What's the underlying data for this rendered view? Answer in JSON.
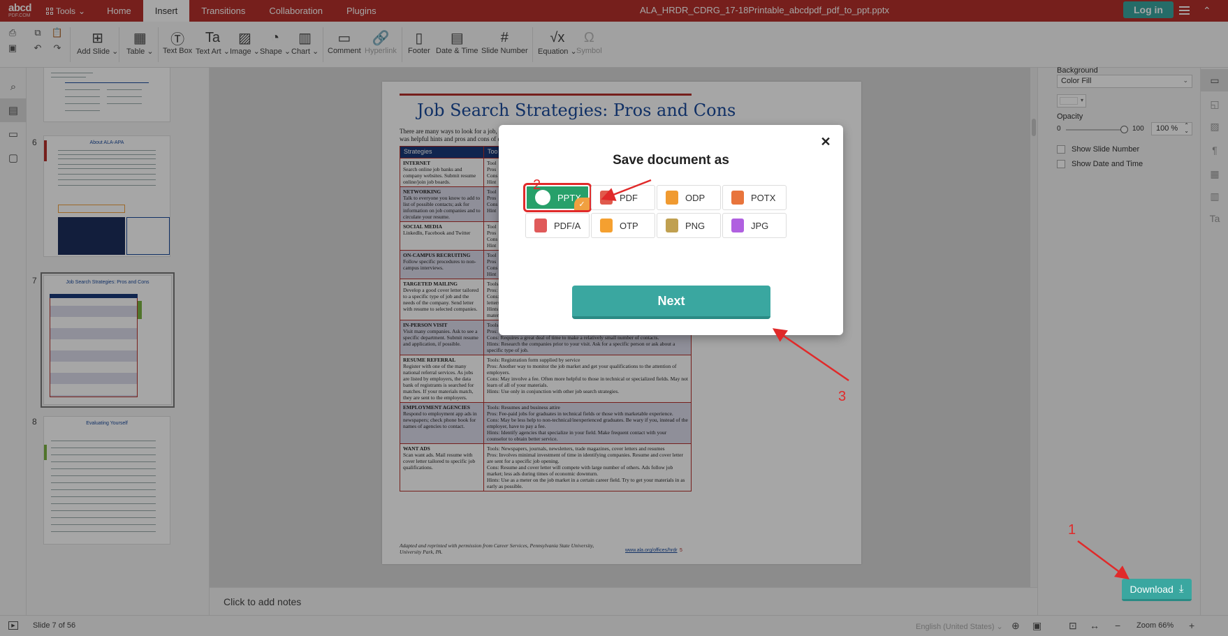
{
  "app": {
    "logo_main": "abcd",
    "logo_sub": "PDF.COM",
    "tools_label": "Tools",
    "doc_title": "ALA_HRDR_CDRG_17-18Printable_abcdpdf_pdf_to_ppt.pptx",
    "login_label": "Log in"
  },
  "menu_tabs": [
    {
      "label": "Home"
    },
    {
      "label": "Insert"
    },
    {
      "label": "Transitions"
    },
    {
      "label": "Collaboration"
    },
    {
      "label": "Plugins"
    }
  ],
  "ribbon": {
    "add_slide": "Add Slide",
    "table": "Table",
    "text_box": "Text Box",
    "text_art": "Text Art",
    "image": "Image",
    "shape": "Shape",
    "chart": "Chart",
    "comment": "Comment",
    "hyperlink": "Hyperlink",
    "footer": "Footer",
    "date_time": "Date & Time",
    "slide_number": "Slide Number",
    "equation": "Equation",
    "symbol": "Symbol"
  },
  "thumbnails": [
    {
      "num": "6",
      "title": "About ALA-APA"
    },
    {
      "num": "7",
      "title": "Job Search Strategies: Pros and Cons"
    },
    {
      "num": "8",
      "title": "Evaluating Yourself"
    }
  ],
  "slide": {
    "title": "Job Search Strategies: Pros and Cons",
    "intro_1": "There are many ways to look for a job, so...",
    "intro_2": "was helpful hints and pros and cons of e...",
    "col1_header": "Strategies",
    "col2_header": "Too",
    "rows": [
      {
        "name": "INTERNET",
        "desc": "Search online job banks and company websites. Submit resume online/join job boards.",
        "detail": "Tool\nPros\nCons\nHint",
        "shade": false
      },
      {
        "name": "NETWORKING",
        "desc": "Talk to everyone you know to add to list of possible contacts; ask for information on job companies and to circulate your resume.",
        "detail": "Tool\nPros\nCons\nHint",
        "shade": true
      },
      {
        "name": "SOCIAL MEDIA",
        "desc": "LinkedIn, Facebook and Twitter",
        "detail": "Tool\nPros\nCons\nHint",
        "shade": false
      },
      {
        "name": "ON-CAMPUS RECRUITING",
        "desc": "Follow specific procedures to non-campus interviews.",
        "detail": "Tool\nPros\nCons\nHint",
        "shade": true
      },
      {
        "name": "TARGETED MAILING",
        "desc": "Develop a good cover letter tailored to a specific type of job and the needs of the company. Send letter with resume to selected companies.",
        "detail": "Tools\nPros: ...specific employers.\nCons: Requires a significant investment of time in researching companies and writing cover letters as well as following up with contacts.\nHints: Try to find out who is in charge of the area in which you want to work; send your materials to the person. Great method when used in conjunction with networking.",
        "shade": false
      },
      {
        "name": "IN-PERSON VISIT",
        "desc": "Visit many companies. Ask to see a specific department. Submit resume and application, if possible.",
        "detail": "Tools: Business attire, company address list and resumes\nPros: Resume and applications are on file with the company.\nCons: Requires a great deal of time to make a relatively small number of contacts.\nHints: Research the companies prior to your visit. Ask for a specific person or ask about a specific type of job.",
        "shade": true
      },
      {
        "name": "RESUME REFERRAL",
        "desc": "Register with one of the many national referral services. As jobs are listed by employers, the data bank of registrants is searched for matches. If your materials match, they are sent to the employers.",
        "detail": "Tools: Registration form supplied by service\nPros: Another way to monitor the job market and get your qualifications to the attention of employers.\nCons: May involve a fee. Often more helpful to those in technical or specialized fields. May not learn of all of your materials.\nHints: Use only in conjunction with other job search strategies.",
        "shade": false
      },
      {
        "name": "EMPLOYMENT AGENCIES",
        "desc": "Respond to employment app ads in newspapers; check phone book for names of agencies to contact.",
        "detail": "Tools: Resumes and business attire\nPros: Fee-paid jobs for graduates in technical fields or those with marketable experience.\nCons: May be less help to non-technical/inexperienced graduates. Be wary if you, instead of the employer, have to pay a fee.\nHints: Identify agencies that specialize in your field. Make frequent contact with your counselor to obtain better service.",
        "shade": true
      },
      {
        "name": "WANT ADS",
        "desc": "Scan want ads. Mail resume with cover letter tailored to specific job qualifications.",
        "detail": "Tools: Newspapers, journals, newsletters, trade magazines, cover letters and resumes\nPros: Involves minimal investment of time in identifying companies. Resume and cover letter are sent for a specific job opening.\nCons: Resume and cover letter will compete with large number of others. Ads follow job market; less ads during times of economic downturn.\nHints: Use as a meter on the job market in a certain career field. Try to get your materials in as early as possible.",
        "shade": false
      }
    ],
    "footnote": "Adapted and reprinted with permission from Career Services, Pennsylvania State University, University Park, PA.",
    "link": "www.ala.org/offices/hrdr",
    "page": "5"
  },
  "notes_placeholder": "Click to add notes",
  "right_panel": {
    "background_label": "Background",
    "fill_value": "Color Fill",
    "opacity_label": "Opacity",
    "opacity_min": "0",
    "opacity_max": "100",
    "opacity_value": 1.0,
    "opacity_pct": "100 %",
    "show_slide_number": "Show Slide Number",
    "show_date_time": "Show Date and Time"
  },
  "status": {
    "slide_count": "Slide 7 of 56",
    "language": "English (United States)",
    "zoom": "Zoom 66%"
  },
  "download_label": "Download",
  "modal": {
    "title": "Save document as",
    "formats": [
      {
        "label": "PPTX",
        "color": "#e0442c",
        "selected": true
      },
      {
        "label": "PDF",
        "color": "#e05a4c",
        "selected": false
      },
      {
        "label": "ODP",
        "color": "#f09a30",
        "selected": false
      },
      {
        "label": "POTX",
        "color": "#e8743c",
        "selected": false
      },
      {
        "label": "PDF/A",
        "color": "#e05a5a",
        "selected": false
      },
      {
        "label": "OTP",
        "color": "#f5a030",
        "selected": false
      },
      {
        "label": "PNG",
        "color": "#c0a050",
        "selected": false
      },
      {
        "label": "JPG",
        "color": "#b060e0",
        "selected": false
      }
    ],
    "next_label": "Next"
  },
  "annotations": {
    "n1": "1",
    "n2": "2",
    "n3": "3",
    "color": "#e02a2a"
  }
}
